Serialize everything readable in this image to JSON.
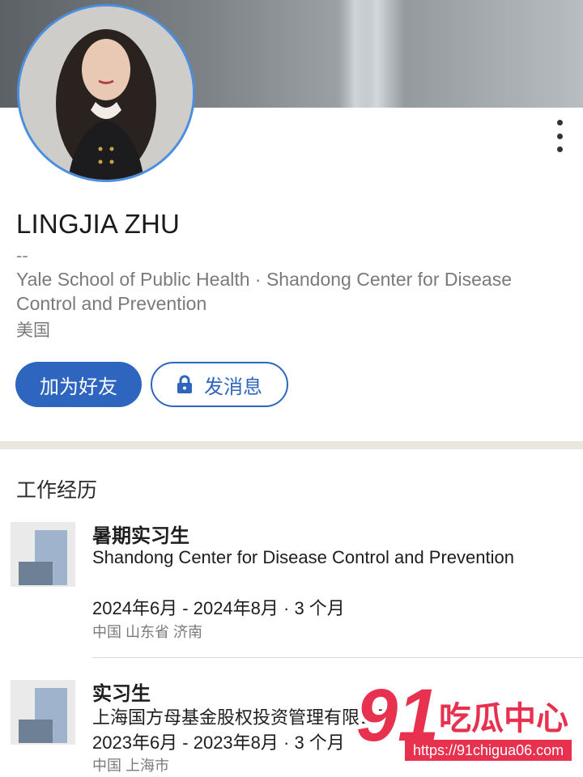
{
  "profile": {
    "name": "LINGJIA ZHU",
    "headline": "--",
    "education_line": "Yale School of Public Health  ·  Shandong Center for Disease Control and Prevention",
    "location": "美国"
  },
  "actions": {
    "add_friend": "加为好友",
    "message": "发消息",
    "message_icon": "lock-icon",
    "more_icon": "more-vertical-icon"
  },
  "experience": {
    "section_title": "工作经历",
    "items": [
      {
        "title": "暑期实习生",
        "company": "Shandong Center for Disease Control and Prevention",
        "dates": "2024年6月 - 2024年8月  ·  3 个月",
        "location": "中国 山东省 济南"
      },
      {
        "title": "实习生",
        "company": "上海国方母基金股权投资管理有限公司",
        "dates": "2023年6月 - 2023年8月  ·  3 个月",
        "location": "中国 上海市"
      }
    ]
  },
  "watermark": {
    "number": "91",
    "text": "吃瓜中心",
    "url": "https://91chigua06.com"
  },
  "colors": {
    "accent": "#2e66bf",
    "watermark": "#e8304f"
  }
}
